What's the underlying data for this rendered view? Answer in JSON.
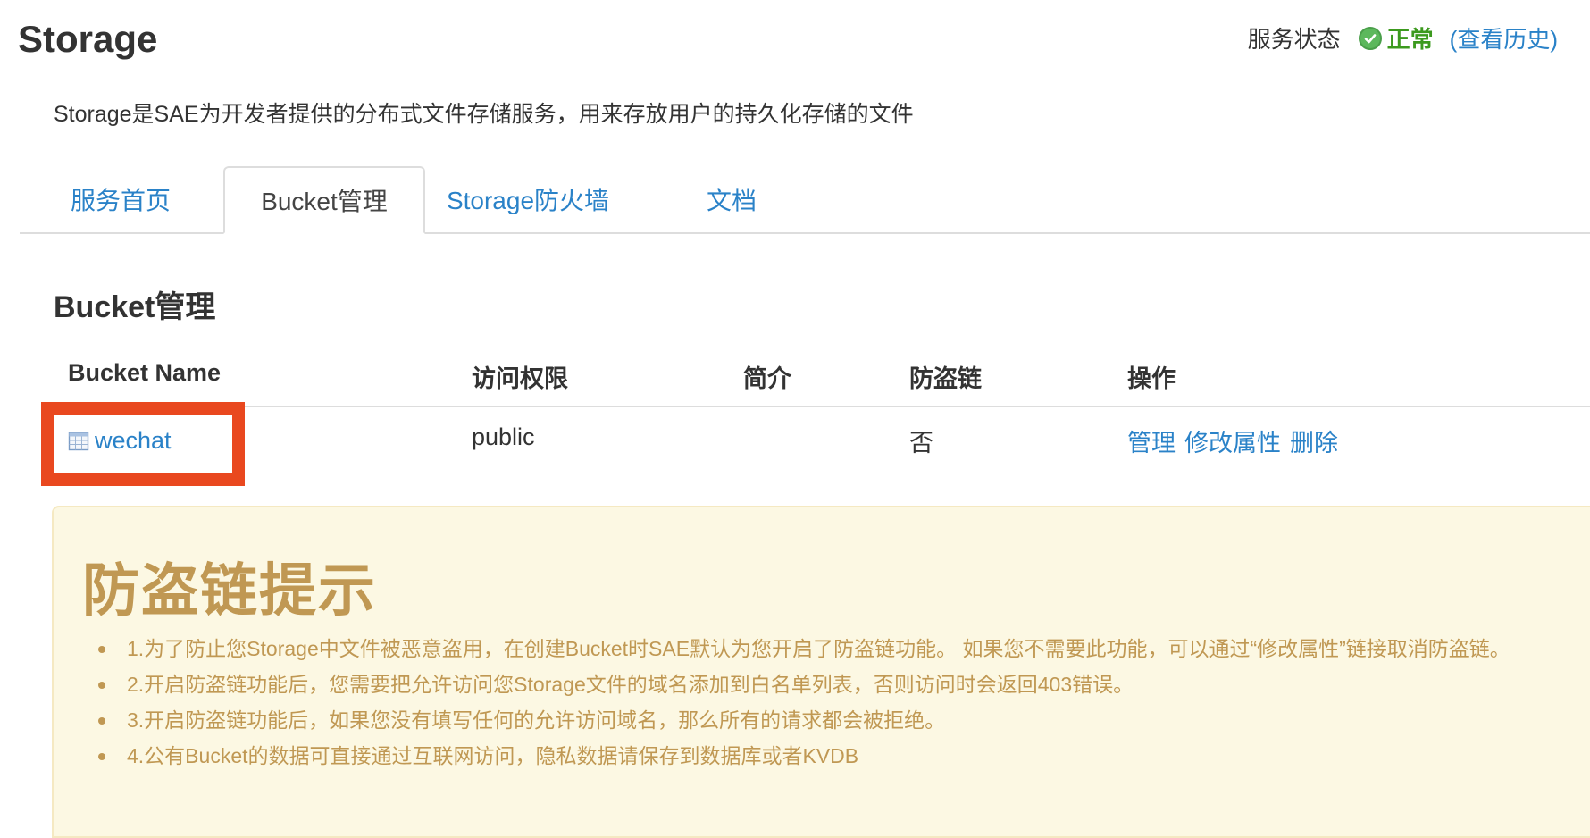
{
  "header": {
    "title": "Storage",
    "status_label": "服务状态",
    "status_value": "正常",
    "status_history": "(查看历史)"
  },
  "description": "Storage是SAE为开发者提供的分布式文件存储服务，用来存放用户的持久化存储的文件",
  "tabs": [
    {
      "label": "服务首页",
      "active": false
    },
    {
      "label": "Bucket管理",
      "active": true
    },
    {
      "label": "Storage防火墙",
      "active": false
    },
    {
      "label": "文档",
      "active": false
    }
  ],
  "section_title": "Bucket管理",
  "table": {
    "headers": [
      "Bucket Name",
      "访问权限",
      "简介",
      "防盗链",
      "操作"
    ],
    "rows": [
      {
        "name": "wechat",
        "access": "public",
        "intro": "",
        "hotlink": "否",
        "actions": [
          "管理",
          "修改属性",
          "删除"
        ]
      }
    ]
  },
  "alert": {
    "title": "防盗链提示",
    "items": [
      "1.为了防止您Storage中文件被恶意盗用，在创建Bucket时SAE默认为您开启了防盗链功能。 如果您不需要此功能，可以通过“修改属性”链接取消防盗链。",
      "2.开启防盗链功能后，您需要把允许访问您Storage文件的域名添加到白名单列表，否则访问时会返回403错误。",
      "3.开启防盗链功能后，如果您没有填写任何的允许访问域名，那么所有的请求都会被拒绝。",
      "4.公有Bucket的数据可直接通过互联网访问，隐私数据请保存到数据库或者KVDB"
    ]
  },
  "colors": {
    "link": "#2a82c8",
    "status_ok": "#3c9a1e",
    "highlight_box": "#e9481f",
    "alert_bg": "#fcf8e3",
    "alert_text": "#c09853"
  },
  "icons": {
    "status": "check-circle-icon",
    "bucket": "table-icon"
  }
}
